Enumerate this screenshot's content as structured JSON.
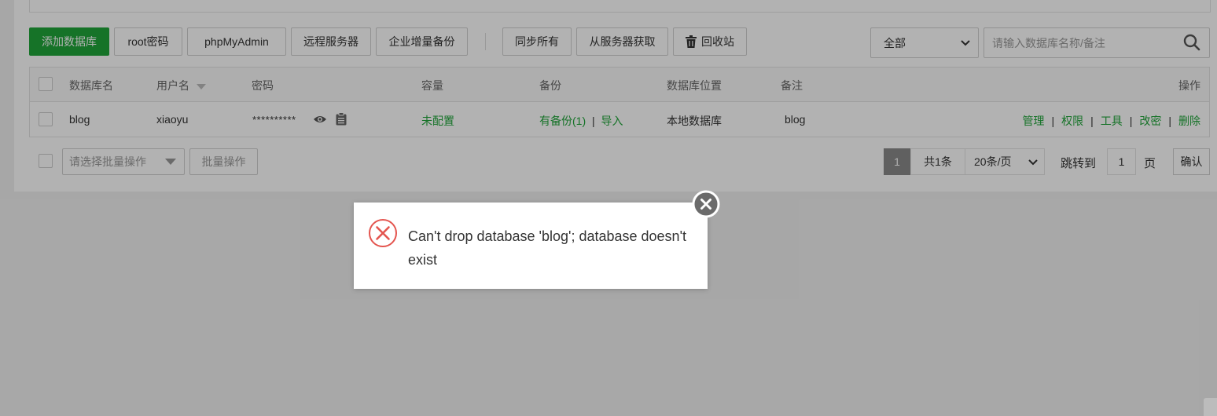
{
  "toolbar": {
    "add_db": "添加数据库",
    "root_password": "root密码",
    "phpmyadmin": "phpMyAdmin",
    "remote_server": "远程服务器",
    "enterprise_backup": "企业增量备份",
    "sync_all": "同步所有",
    "fetch_from_server": "从服务器获取",
    "recycle_bin": "回收站"
  },
  "filter": {
    "selected": "全部"
  },
  "search": {
    "placeholder": "请输入数据库名称/备注",
    "icon": "search-icon"
  },
  "table": {
    "headers": {
      "name": "数据库名",
      "username": "用户名",
      "password": "密码",
      "capacity": "容量",
      "backup": "备份",
      "location": "数据库位置",
      "note": "备注",
      "actions": "操作"
    },
    "rows": [
      {
        "name": "blog",
        "username": "xiaoyu",
        "password": "**********",
        "capacity": "未配置",
        "backup": "有备份(1)",
        "backup_sep": "|",
        "import": "导入",
        "location": "本地数据库",
        "note": "blog",
        "actions": {
          "manage": "管理",
          "permissions": "权限",
          "tools": "工具",
          "change_password": "改密",
          "delete": "删除"
        }
      }
    ]
  },
  "batch": {
    "select_placeholder": "请选择批量操作",
    "button": "批量操作"
  },
  "pagination": {
    "current": "1",
    "total": "共1条",
    "per_page": "20条/页",
    "goto_label": "跳转到",
    "goto_value": "1",
    "page_suffix": "页",
    "confirm": "确认"
  },
  "dialog": {
    "message": "Can't drop database 'blog'; database doesn't exist",
    "icon": "error-icon",
    "close_icon": "close-icon"
  },
  "colors": {
    "brand": "#20a53a",
    "error": "#e4554f"
  }
}
